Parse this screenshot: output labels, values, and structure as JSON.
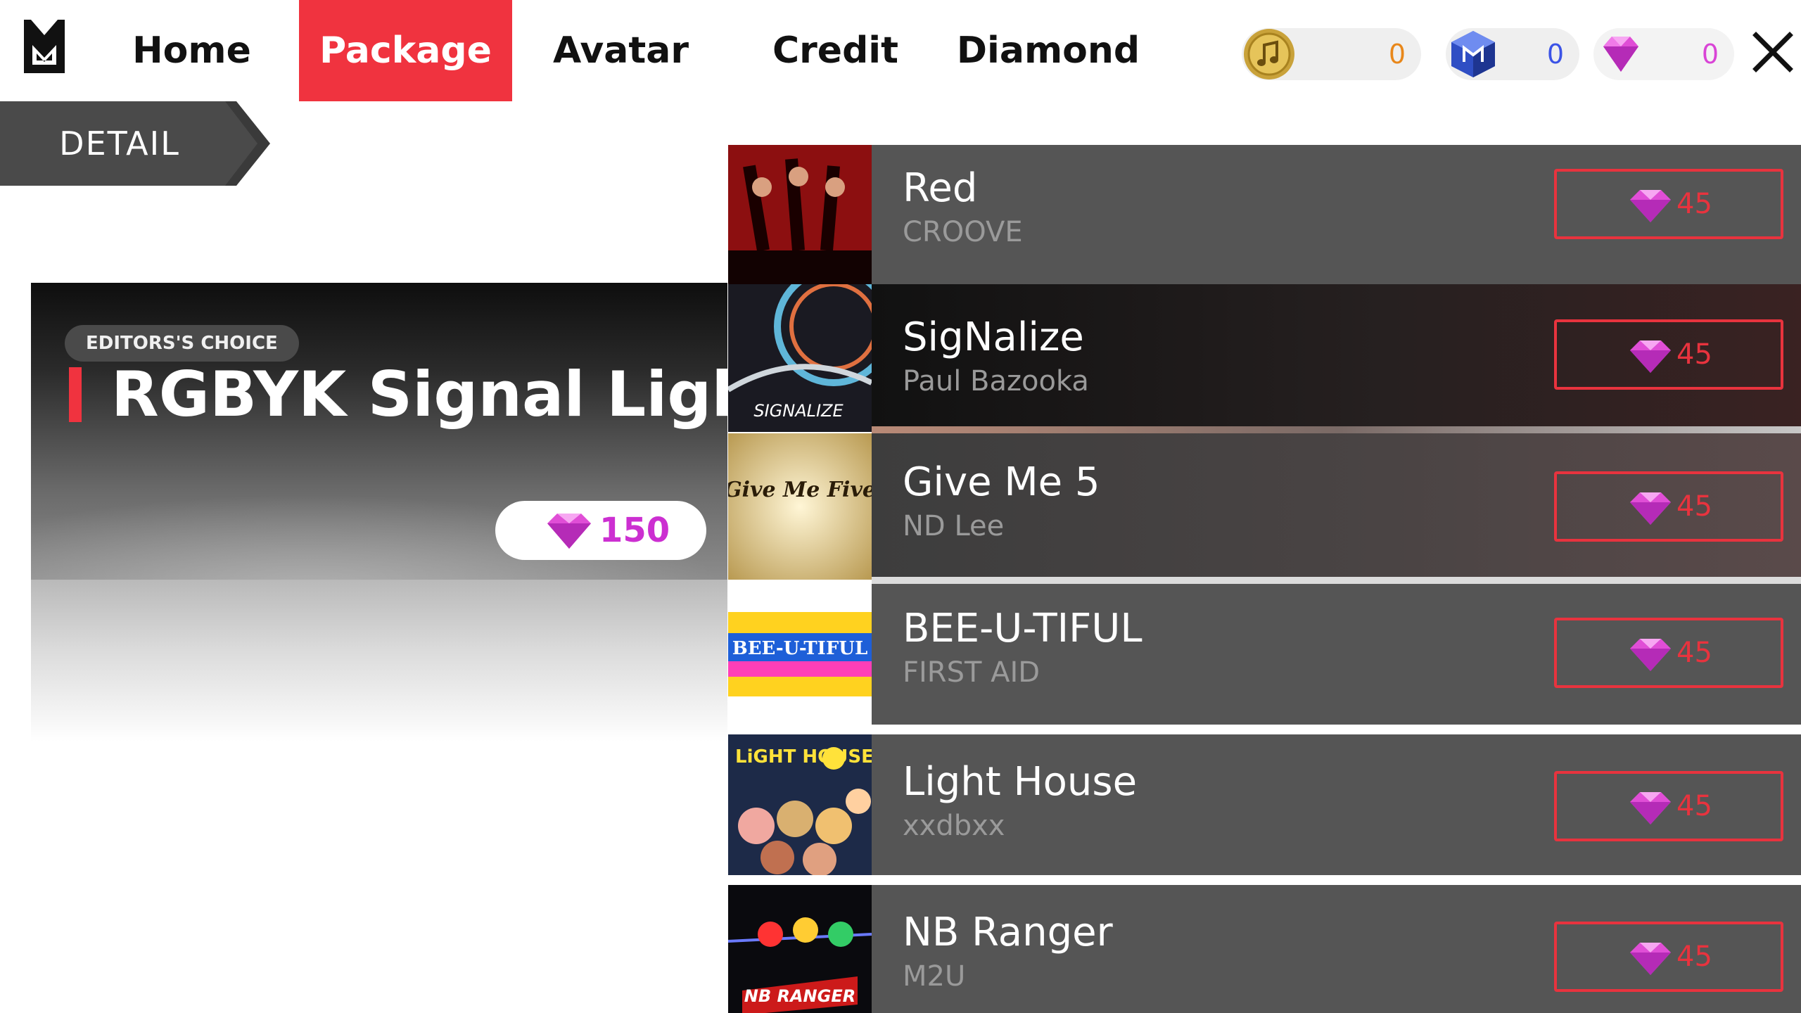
{
  "header": {
    "tabs": [
      {
        "label": "Home",
        "active": false
      },
      {
        "label": "Package",
        "active": true
      },
      {
        "label": "Avatar",
        "active": false
      },
      {
        "label": "Credit",
        "active": false
      },
      {
        "label": "Diamond",
        "active": false
      }
    ],
    "currencies": [
      {
        "icon": "music-coin-icon",
        "value": "0",
        "color": "#e8871a"
      },
      {
        "icon": "cube-icon",
        "value": "0",
        "color": "#3b53e6"
      },
      {
        "icon": "diamond-icon",
        "value": "0",
        "color": "#d944d6"
      }
    ],
    "close_icon": "close-icon"
  },
  "detail_tag": {
    "label": "DETAIL"
  },
  "featured": {
    "badge": "EDITORS'S CHOICE",
    "title": "RGBYK Signal Light",
    "price": "150",
    "price_icon": "diamond-icon"
  },
  "songs": [
    {
      "title": "Red",
      "artist": "CROOVE",
      "price": "45"
    },
    {
      "title": "SigNalize",
      "artist": "Paul Bazooka",
      "price": "45"
    },
    {
      "title": "Give Me 5",
      "artist": "ND Lee",
      "price": "45"
    },
    {
      "title": "BEE-U-TIFUL",
      "artist": "FIRST AID",
      "price": "45"
    },
    {
      "title": "Light House",
      "artist": "xxdbxx",
      "price": "45"
    },
    {
      "title": "NB Ranger",
      "artist": "M2U",
      "price": "45"
    }
  ],
  "cover_text": {
    "give_me_five": "Give Me Five",
    "bee": "BEE-U-TIFUL",
    "signalize": "SIGNALIZE",
    "light_house": "LiGHT HOUSE",
    "nb_ranger": "NB RANGER"
  },
  "colors": {
    "accent": "#f0333f",
    "price_red": "#e8333e",
    "diamond_pink": "#cc2fd1"
  }
}
